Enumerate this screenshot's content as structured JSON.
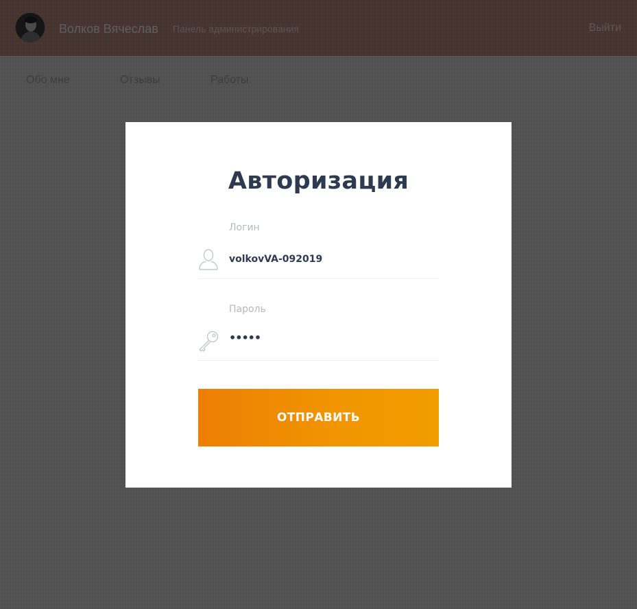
{
  "header": {
    "user_name": "Волков Вячеслав",
    "panel_title": "Панель администрирования",
    "logout_label": "Выйти"
  },
  "tabs": [
    {
      "label": "Обо мне"
    },
    {
      "label": "Отзывы"
    },
    {
      "label": "Работы"
    }
  ],
  "auth": {
    "title": "Авторизация",
    "login": {
      "label": "Логин",
      "value": "volkovVA-092019",
      "icon": "user-icon"
    },
    "password": {
      "label": "Пароль",
      "value": "•••••",
      "icon": "key-icon"
    },
    "submit_label": "ОТПРАВИТЬ"
  },
  "colors": {
    "accent_start": "#ee7e04",
    "accent_end": "#f39c00",
    "title": "#2d3a50"
  }
}
